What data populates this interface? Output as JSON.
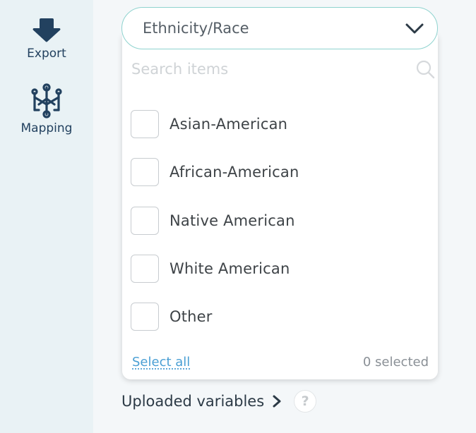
{
  "sidebar": {
    "export": {
      "label": "Export",
      "icon": "download-arrow-icon"
    },
    "mapping": {
      "label": "Mapping",
      "icon": "mapping-icon"
    }
  },
  "select": {
    "value": "Ethnicity/Race",
    "icon": "chevron-down-icon",
    "border_color": "#8fd3cf"
  },
  "dropdown": {
    "search_placeholder": "Search items",
    "options": [
      {
        "label": "Asian-American",
        "checked": false
      },
      {
        "label": "African-American",
        "checked": false
      },
      {
        "label": "Native American",
        "checked": false
      },
      {
        "label": "White American",
        "checked": false
      },
      {
        "label": "Other",
        "checked": false
      }
    ],
    "select_all_label": "Select all",
    "selected_count": "0 selected"
  },
  "uploaded": {
    "label": "Uploaded variables",
    "help_label": "?"
  },
  "colors": {
    "sidebar_bg": "#e9f2f5",
    "icon_navy": "#22415f",
    "link_blue": "#4a9fd4"
  }
}
